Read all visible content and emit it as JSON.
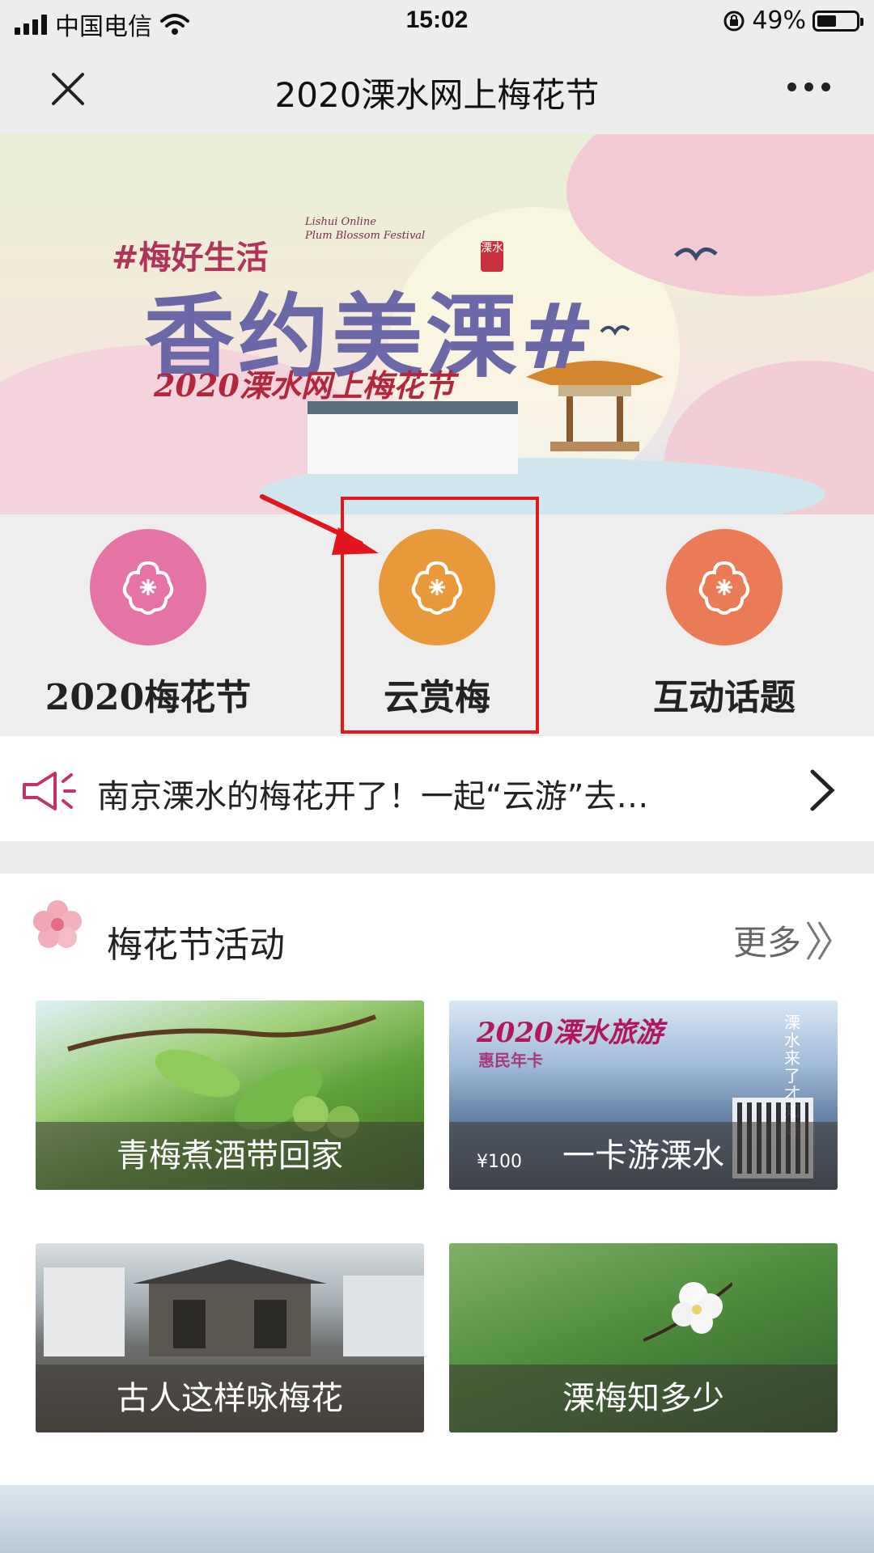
{
  "status_bar": {
    "carrier": "中国电信",
    "time": "15:02",
    "battery_percent": "49%",
    "battery_level": 0.49
  },
  "nav": {
    "title": "2020溧水网上梅花节",
    "close_icon": "close-icon",
    "more_icon": "more-icon"
  },
  "banner": {
    "tag_text": "#梅好生活",
    "english_text_line1": "Lishui Online",
    "english_text_line2": "Plum Blossom Festival",
    "main_text": "香约美溧#",
    "seal_text": "溧水",
    "subtitle": "2020溧水网上梅花节"
  },
  "quick_links": [
    {
      "label": "2020梅花节",
      "icon": "plum-blossom-icon",
      "color": "#e573a6"
    },
    {
      "label": "云赏梅",
      "icon": "plum-blossom-icon",
      "color": "#e89a3a"
    },
    {
      "label": "互动话题",
      "icon": "plum-blossom-icon",
      "color": "#ea7b56"
    }
  ],
  "annotation": {
    "highlight_color": "#e4151d"
  },
  "notice": {
    "icon": "speaker-icon",
    "text": "南京溧水的梅花开了！一起“云游”去…",
    "chevron": "chevron-right-icon"
  },
  "activities": {
    "title": "梅花节活动",
    "more_label": "更多",
    "items": [
      {
        "caption": "青梅煮酒带回家"
      },
      {
        "caption": "一卡游溧水",
        "card_title": "2020溧水旅游",
        "card_subtitle": "惠民年卡",
        "price": "¥100",
        "vertical_text": "溧水来了才知好"
      },
      {
        "caption": "古人这样咏梅花"
      },
      {
        "caption": "溧梅知多少"
      }
    ]
  }
}
